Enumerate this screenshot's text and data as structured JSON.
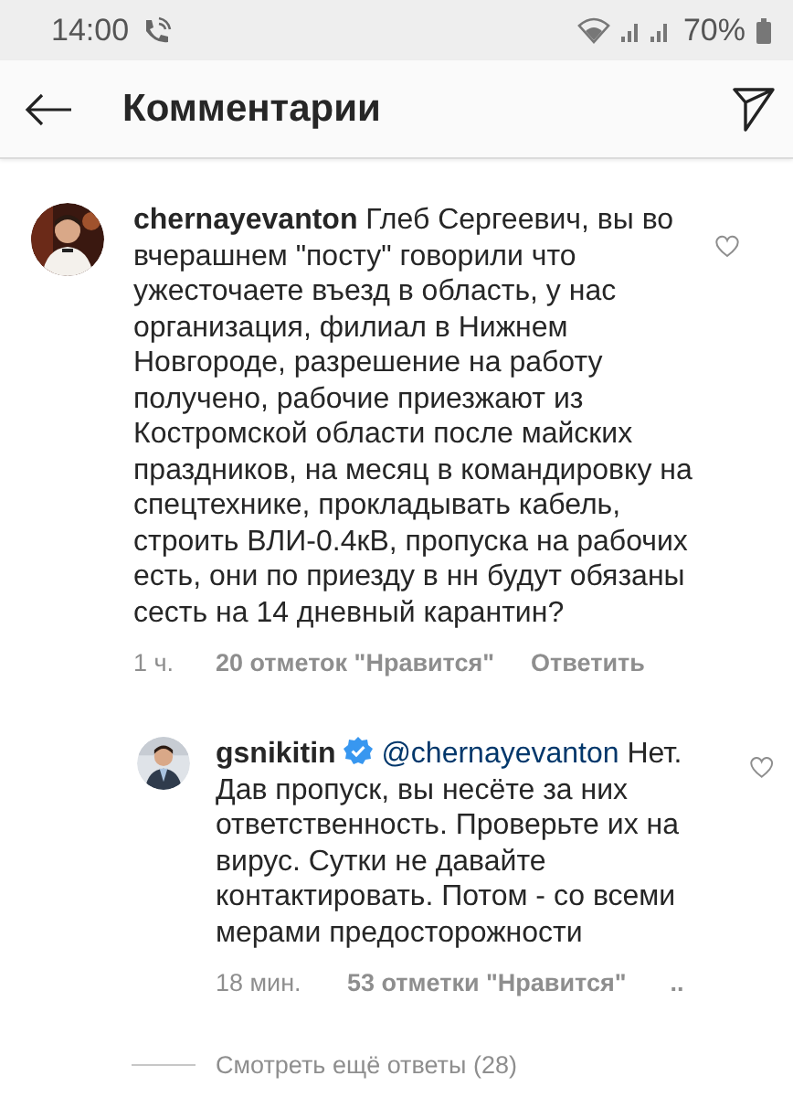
{
  "status_bar": {
    "time": "14:00",
    "battery": "70%"
  },
  "header": {
    "title": "Комментарии"
  },
  "comment": {
    "username": "chernayevanton",
    "text": "Глеб Сергеевич, вы во вчерашнем \"посту\" говорили что ужесточаете въезд в область, у нас организация, филиал в Нижнем Новгороде, разрешение на работу получено, рабочие приезжают из Костромской области после майских праздников, на месяц в командировку на спецтехнике, прокладывать кабель, строить ВЛИ-0.4кВ, пропуска на рабочих есть, они по приезду в нн будут обязаны сесть на 14 дневный карантин?",
    "time": "1 ч.",
    "likes": "20 отметок \"Нравится\"",
    "reply_label": "Ответить"
  },
  "reply": {
    "username": "gsnikitin",
    "verified": true,
    "mention": "@chernayevanton",
    "text": "Нет. Дав пропуск, вы несёте за них ответственность. Проверьте их на вирус. Сутки не давайте контактировать. Потом - со всеми мерами предосторожности",
    "time": "18 мин.",
    "likes": "53 отметки \"Нравится\"",
    "more": ".."
  },
  "view_more": "Смотреть ещё ответы (28)"
}
